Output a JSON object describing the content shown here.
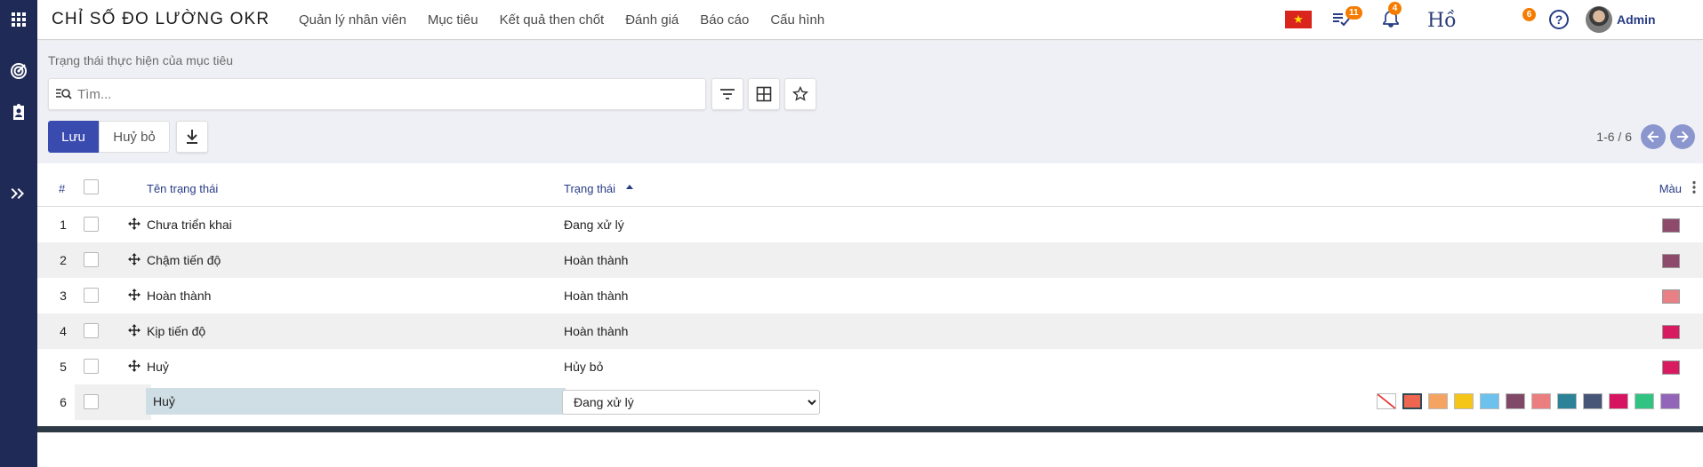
{
  "app": {
    "title": "CHỈ SỐ ĐO LƯỜNG OKR",
    "menu": [
      "Quản lý nhân viên",
      "Mục tiêu",
      "Kết quả then chốt",
      "Đánh giá",
      "Báo cáo",
      "Cấu hình"
    ]
  },
  "topbar": {
    "activities_count": "11",
    "notifications_count": "4",
    "ho_text": "Hồ",
    "extra_count": "6",
    "user_name": "Admin",
    "flag_star": "★"
  },
  "breadcrumb": "Trạng thái thực hiện của mục tiêu",
  "search": {
    "placeholder": "Tìm..."
  },
  "actions": {
    "save_label": "Lưu",
    "cancel_label": "Huỷ bỏ"
  },
  "pager": {
    "text": "1-6 / 6"
  },
  "table": {
    "columns": {
      "index": "#",
      "name": "Tên trạng thái",
      "status": "Trạng thái",
      "color": "Màu"
    },
    "rows": [
      {
        "index": "1",
        "name": "Chưa triển khai",
        "status": "Đang xử lý",
        "color": "#8e4a6a"
      },
      {
        "index": "2",
        "name": "Chậm tiến độ",
        "status": "Hoàn thành",
        "color": "#8e4a6a"
      },
      {
        "index": "3",
        "name": "Hoàn thành",
        "status": "Hoàn thành",
        "color": "#e98085"
      },
      {
        "index": "4",
        "name": "Kịp tiến độ",
        "status": "Hoàn thành",
        "color": "#d81b60"
      },
      {
        "index": "5",
        "name": "Huỷ",
        "status": "Hủy bỏ",
        "color": "#d81b60"
      }
    ],
    "edit_row": {
      "index": "6",
      "name": "Huỷ",
      "status": "Đang xử lý",
      "status_options": [
        "Đang xử lý"
      ]
    },
    "palette": [
      "none",
      "#ee6650",
      "#f4a460",
      "#f5c518",
      "#6cc1ed",
      "#814968",
      "#eb7e7f",
      "#2c8397",
      "#475577",
      "#d6145f",
      "#30c381",
      "#9365b8"
    ]
  }
}
